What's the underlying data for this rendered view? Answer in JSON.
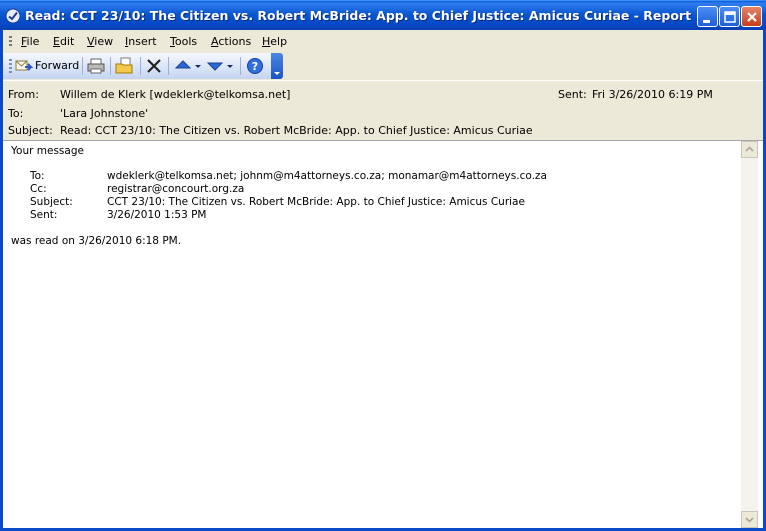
{
  "window": {
    "title": "Read: CCT 23/10: The Citizen vs. Robert McBride: App. to Chief Justice: Amicus Curiae  - Report"
  },
  "menu": {
    "items": [
      {
        "label": "File"
      },
      {
        "label": "Edit"
      },
      {
        "label": "View"
      },
      {
        "label": "Insert"
      },
      {
        "label": "Tools"
      },
      {
        "label": "Actions"
      },
      {
        "label": "Help"
      }
    ]
  },
  "toolbar": {
    "forward_label": "Forward",
    "icons": [
      "forward-icon",
      "print-icon",
      "move-to-folder-icon",
      "delete-icon",
      "previous-item-icon",
      "next-item-icon",
      "help-icon"
    ]
  },
  "header": {
    "from_label": "From:",
    "from_value": "Willem de Klerk [wdeklerk@telkomsa.net]",
    "sent_label": "Sent:",
    "sent_value": "Fri 3/26/2010 6:19 PM",
    "to_label": "To:",
    "to_value": "'Lara Johnstone'",
    "subject_label": "Subject:",
    "subject_value": "Read: CCT 23/10: The Citizen vs. Robert McBride: App. to Chief Justice: Amicus Curiae"
  },
  "body": {
    "intro": "Your message",
    "to_label": "To:",
    "to_value": "wdeklerk@telkomsa.net; johnm@m4attorneys.co.za; monamar@m4attorneys.co.za",
    "cc_label": "Cc:",
    "cc_value": "registrar@concourt.org.za",
    "subject_label": "Subject:",
    "subject_value": "CCT 23/10: The Citizen vs. Robert McBride: App. to Chief Justice: Amicus Curiae",
    "sent_label": "Sent:",
    "sent_value": "3/26/2010 1:53 PM",
    "read_line": "was read on 3/26/2010 6:18 PM."
  },
  "colors": {
    "title_bar": "#0a57d0",
    "chrome": "#ece9d8",
    "toolbar_gradient_top": "#f6f8fd",
    "toolbar_gradient_bottom": "#c4d3ef"
  }
}
